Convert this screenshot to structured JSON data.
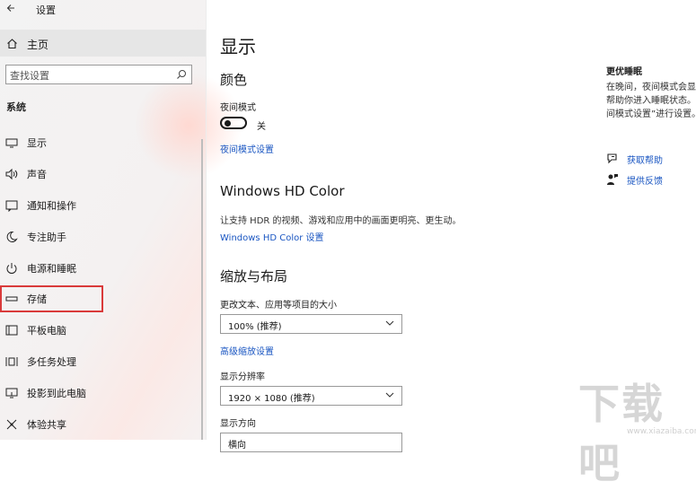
{
  "window": {
    "title": "设置"
  },
  "sidebar": {
    "home_label": "主页",
    "search_placeholder": "查找设置",
    "section_label": "系统",
    "items": [
      {
        "label": "显示",
        "icon": "display-icon"
      },
      {
        "label": "声音",
        "icon": "speaker-icon"
      },
      {
        "label": "通知和操作",
        "icon": "notification-icon"
      },
      {
        "label": "专注助手",
        "icon": "moon-icon"
      },
      {
        "label": "电源和睡眠",
        "icon": "power-icon"
      },
      {
        "label": "存储",
        "icon": "storage-icon",
        "highlighted": true
      },
      {
        "label": "平板电脑",
        "icon": "tablet-icon"
      },
      {
        "label": "多任务处理",
        "icon": "multitask-icon"
      },
      {
        "label": "投影到此电脑",
        "icon": "project-icon"
      },
      {
        "label": "体验共享",
        "icon": "share-icon"
      }
    ]
  },
  "main": {
    "page_title": "显示",
    "color": {
      "heading": "颜色",
      "night_mode_label": "夜间模式",
      "night_mode_state": "关",
      "night_mode_on": false,
      "night_mode_link": "夜间模式设置"
    },
    "hd_color": {
      "heading": "Windows HD Color",
      "desc": "让支持 HDR 的视频、游戏和应用中的画面更明亮、更生动。",
      "link": "Windows HD Color 设置"
    },
    "scale": {
      "heading": "缩放与布局",
      "text_size_label": "更改文本、应用等项目的大小",
      "text_size_value": "100% (推荐)",
      "advanced_link": "高级缩放设置",
      "resolution_label": "显示分辨率",
      "resolution_value": "1920 × 1080 (推荐)",
      "orientation_label": "显示方向",
      "orientation_value": "横向"
    }
  },
  "right_panel": {
    "title": "更优睡眠",
    "desc": "在晚间，夜间模式会显示暖色，帮助你进入睡眠状态。选择“夜间模式设置”进行设置。",
    "help_label": "获取帮助",
    "feedback_label": "提供反馈"
  },
  "watermark": {
    "text": "下载吧",
    "url": "www.xiazaiba.com"
  },
  "colors": {
    "accent": "#1a56c2",
    "highlight_border": "#d93a3a",
    "sidebar_bg": "#f3f3f3"
  }
}
